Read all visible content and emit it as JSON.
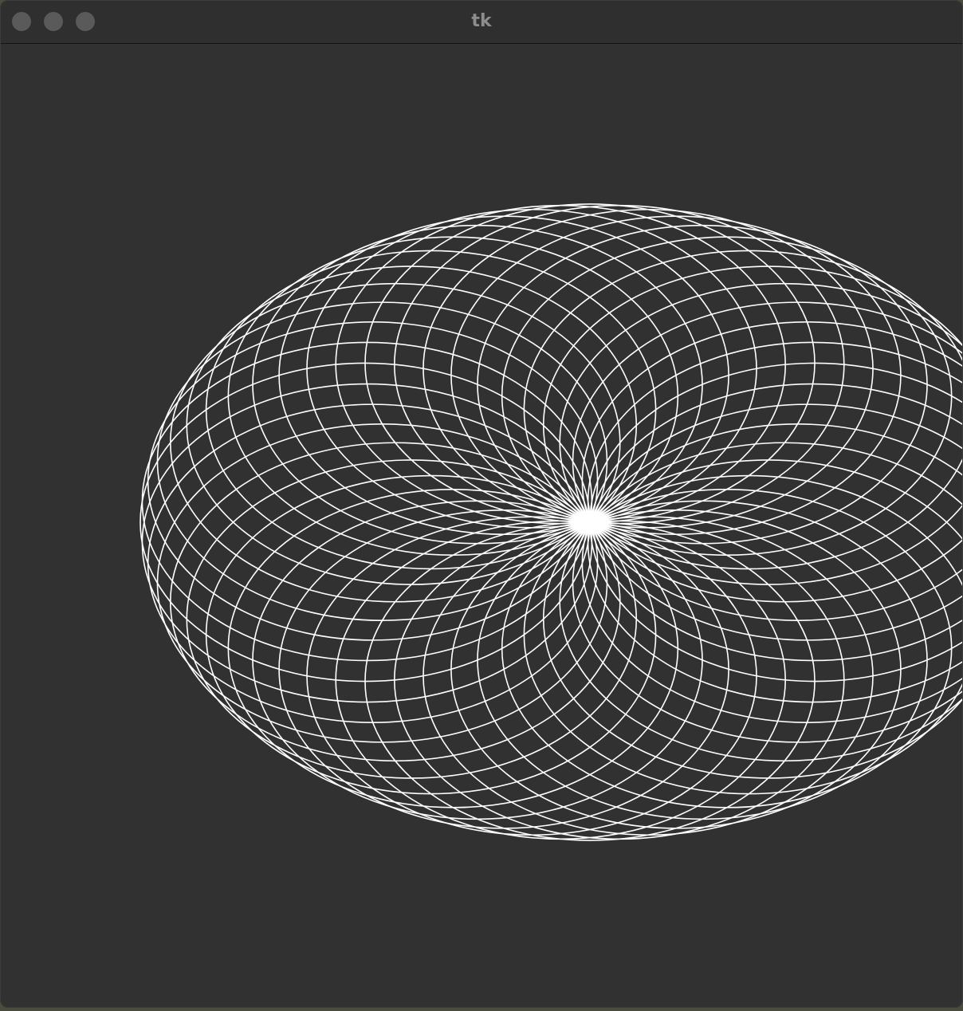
{
  "window": {
    "title": "tk",
    "buttons": {
      "close": "close",
      "minimize": "minimize",
      "zoom": "zoom"
    }
  },
  "canvas": {
    "background_color": "#313131",
    "stroke_color": "#ffffff",
    "circle_count": 48,
    "content": "spirograph-circles"
  }
}
